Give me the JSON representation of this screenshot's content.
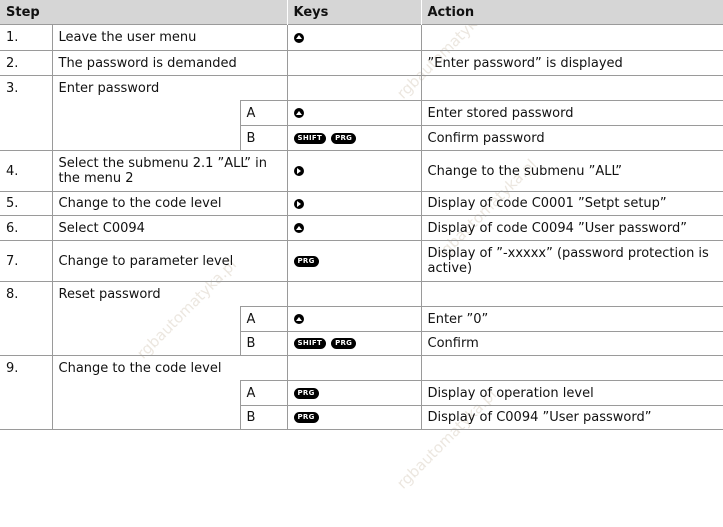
{
  "watermark": "rgbautomatyka.pl",
  "headers": {
    "step": "Step",
    "keys": "Keys",
    "action": "Action"
  },
  "rows": [
    {
      "step": "1.",
      "description": "Leave the user menu",
      "sub": "",
      "keys": [
        "arrow-up"
      ],
      "action": ""
    },
    {
      "step": "2.",
      "description": "The password is demanded",
      "sub": "",
      "keys": [],
      "action": "”Enter password” is displayed"
    },
    {
      "step": "3.",
      "description": "Enter password",
      "sub": "",
      "keys": [],
      "action": ""
    },
    {
      "step": "",
      "description": "",
      "sub": "A",
      "keys": [
        "arrow-up"
      ],
      "action": "Enter stored password"
    },
    {
      "step": "",
      "description": "",
      "sub": "B",
      "keys": [
        "SHIFT",
        "PRG"
      ],
      "action": "Confirm password"
    },
    {
      "step": "4.",
      "description": "Select the submenu 2.1 ”ALL” in the menu 2",
      "sub": "",
      "keys": [
        "arrow-right"
      ],
      "action": "Change to the submenu ”ALL”"
    },
    {
      "step": "5.",
      "description": "Change to the code level",
      "sub": "",
      "keys": [
        "arrow-right"
      ],
      "action": "Display of code C0001 ”Setpt setup”"
    },
    {
      "step": "6.",
      "description": "Select C0094",
      "sub": "",
      "keys": [
        "arrow-up"
      ],
      "action": "Display of code C0094 ”User password”"
    },
    {
      "step": "7.",
      "description": "Change to parameter level",
      "sub": "",
      "keys": [
        "PRG"
      ],
      "action": "Display of ”-xxxxx” (password protection is active)"
    },
    {
      "step": "8.",
      "description": "Reset password",
      "sub": "",
      "keys": [],
      "action": ""
    },
    {
      "step": "",
      "description": "",
      "sub": "A",
      "keys": [
        "arrow-up"
      ],
      "action": "Enter ”0”"
    },
    {
      "step": "",
      "description": "",
      "sub": "B",
      "keys": [
        "SHIFT",
        "PRG"
      ],
      "action": "Confirm"
    },
    {
      "step": "9.",
      "description": "Change to the code level",
      "sub": "",
      "keys": [],
      "action": ""
    },
    {
      "step": "",
      "description": "",
      "sub": "A",
      "keys": [
        "PRG"
      ],
      "action": "Display of operation level"
    },
    {
      "step": "",
      "description": "",
      "sub": "B",
      "keys": [
        "PRG"
      ],
      "action": "Display of C0094 ”User password”"
    }
  ]
}
